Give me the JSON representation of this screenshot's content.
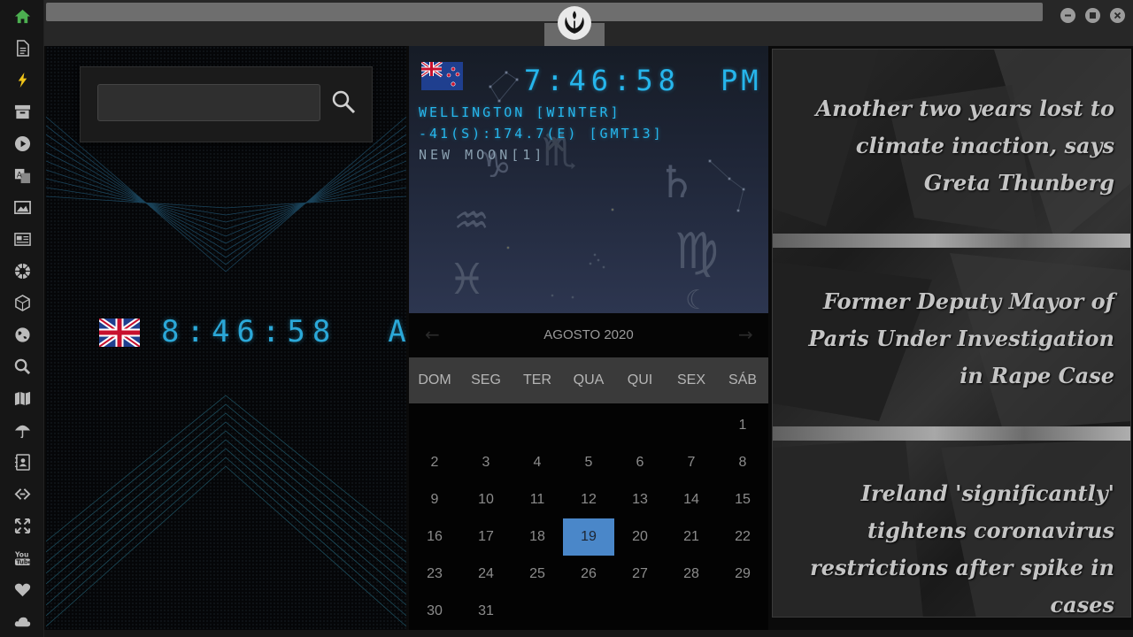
{
  "sidebar": {
    "items": [
      {
        "name": "home-icon",
        "color": "#4caf50"
      },
      {
        "name": "document-icon"
      },
      {
        "name": "lightning-icon",
        "color": "#f0c419"
      },
      {
        "name": "archive-icon"
      },
      {
        "name": "play-icon"
      },
      {
        "name": "translate-icon"
      },
      {
        "name": "image-icon"
      },
      {
        "name": "news-icon"
      },
      {
        "name": "rebel-alliance-icon"
      },
      {
        "name": "hexagon-icon"
      },
      {
        "name": "globe-icon"
      },
      {
        "name": "search-icon"
      },
      {
        "name": "map-icon"
      },
      {
        "name": "umbrella-icon"
      },
      {
        "name": "contacts-icon"
      },
      {
        "name": "link-icon"
      },
      {
        "name": "fullscreen-icon"
      },
      {
        "name": "youtube-icon"
      },
      {
        "name": "heart-icon"
      },
      {
        "name": "cloud-icon"
      }
    ]
  },
  "search": {
    "placeholder": "",
    "value": ""
  },
  "uk_clock": {
    "time": "8:46:58",
    "ampm": "AM"
  },
  "nz_clock": {
    "time": "7:46:58",
    "ampm": "PM",
    "location": "WELLINGTON [WINTER]",
    "coords": "-41(S):174.7(E) [GMT13]",
    "moon": "NEW MOON[1]"
  },
  "calendar": {
    "month_label": "AGOSTO 2020",
    "prev": "←",
    "next": "→",
    "days_of_week": [
      "DOM",
      "SEG",
      "TER",
      "QUA",
      "QUI",
      "SEX",
      "SÁB"
    ],
    "weeks": [
      [
        "",
        "",
        "",
        "",
        "",
        "",
        "1"
      ],
      [
        "2",
        "3",
        "4",
        "5",
        "6",
        "7",
        "8"
      ],
      [
        "9",
        "10",
        "11",
        "12",
        "13",
        "14",
        "15"
      ],
      [
        "16",
        "17",
        "18",
        "19",
        "20",
        "21",
        "22"
      ],
      [
        "23",
        "24",
        "25",
        "26",
        "27",
        "28",
        "29"
      ],
      [
        "30",
        "31",
        "",
        "",
        "",
        "",
        ""
      ]
    ],
    "selected_day": "19",
    "selected_color": "#4a87c9"
  },
  "news": [
    "Another two years lost to climate inaction, says Greta Thunberg",
    "Former Deputy Mayor of Paris Under Investigation in Rape Case",
    "Ireland 'significantly' tightens coronavirus restrictions after spike in cases"
  ],
  "colors": {
    "lcd": "#26b6ec",
    "accent_home": "#4caf50"
  }
}
